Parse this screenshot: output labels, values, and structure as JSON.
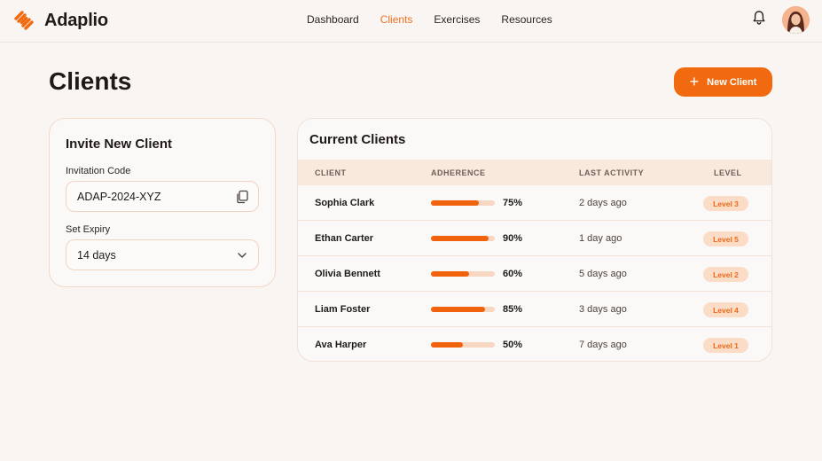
{
  "app": {
    "name": "Adaplio"
  },
  "nav": [
    {
      "label": "Dashboard",
      "active": false
    },
    {
      "label": "Clients",
      "active": true
    },
    {
      "label": "Exercises",
      "active": false
    },
    {
      "label": "Resources",
      "active": false
    }
  ],
  "page": {
    "title": "Clients",
    "new_client_label": "New Client"
  },
  "invite": {
    "title": "Invite New Client",
    "code_label": "Invitation Code",
    "code_value": "ADAP-2024-XYZ",
    "expiry_label": "Set Expiry",
    "expiry_value": "14 days"
  },
  "clients": {
    "title": "Current Clients",
    "columns": [
      "CLIENT",
      "ADHERENCE",
      "LAST ACTIVITY",
      "LEVEL"
    ],
    "rows": [
      {
        "name": "Sophia Clark",
        "adherence": 75,
        "adherence_label": "75%",
        "last_activity": "2 days ago",
        "level": "Level 3"
      },
      {
        "name": "Ethan Carter",
        "adherence": 90,
        "adherence_label": "90%",
        "last_activity": "1 day ago",
        "level": "Level 5"
      },
      {
        "name": "Olivia Bennett",
        "adherence": 60,
        "adherence_label": "60%",
        "last_activity": "5 days ago",
        "level": "Level 2"
      },
      {
        "name": "Liam Foster",
        "adherence": 85,
        "adherence_label": "85%",
        "last_activity": "3 days ago",
        "level": "Level 4"
      },
      {
        "name": "Ava Harper",
        "adherence": 50,
        "adherence_label": "50%",
        "last_activity": "7 days ago",
        "level": "Level 1"
      }
    ]
  },
  "icons": {
    "logo": "dumbbell-logo-icon",
    "notifications": "bell-icon",
    "copy": "copy-icon",
    "dropdown": "chevron-down-icon",
    "add": "plus-icon"
  },
  "colors": {
    "accent": "#f26a10",
    "background": "#f8f5f3",
    "badge_bg": "#fbdcc6"
  }
}
